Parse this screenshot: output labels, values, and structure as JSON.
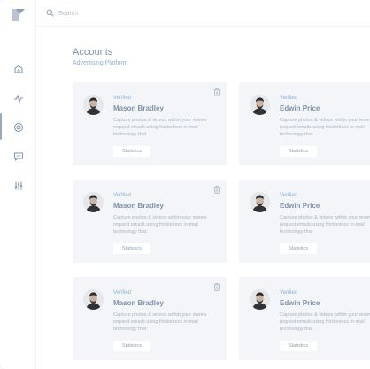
{
  "search": {
    "placeholder": "Search"
  },
  "page": {
    "title": "Accounts",
    "subtitle": "Advertising Platform"
  },
  "nav": [
    "home-icon",
    "activity-icon",
    "target-icon",
    "message-icon",
    "sliders-icon"
  ],
  "cards": [
    {
      "verified": "Verified",
      "name": "Mason Bradley",
      "description": "Capture photos & videos within your review request emails using frictionless in-mail technology that",
      "button": "Statistics"
    },
    {
      "verified": "Verified",
      "name": "Edwin Price",
      "description": "Capture photos & videos within your review request emails using frictionless in-mail technology that",
      "button": "Statistics"
    },
    {
      "verified": "Verified",
      "name": "Mason Bradley",
      "description": "Capture photos & videos within your review request emails using frictionless in-mail technology that",
      "button": "Statistics"
    },
    {
      "verified": "Verified",
      "name": "Edwin Price",
      "description": "Capture photos & videos within your review request emails using frictionless in-mail technology that",
      "button": "Statistics"
    },
    {
      "verified": "Verified",
      "name": "Mason Bradley",
      "description": "Capture photos & videos within your review request emails using frictionless in-mail technology that",
      "button": "Statistics"
    },
    {
      "verified": "Verified",
      "name": "Edwin Price",
      "description": "Capture photos & videos within your review request emails using frictionless in-mail technology that",
      "button": "Statistics"
    }
  ]
}
